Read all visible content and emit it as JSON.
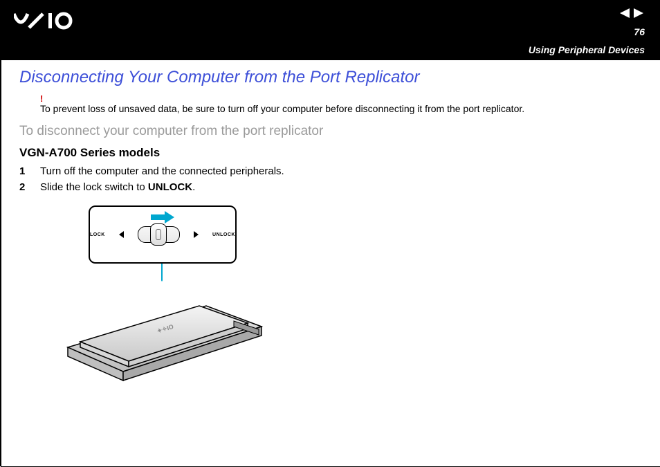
{
  "header": {
    "logo_text": "VAIO",
    "page_number": "76",
    "section": "Using Peripheral Devices"
  },
  "title": "Disconnecting Your Computer from the Port Replicator",
  "warning": {
    "mark": "!",
    "text": "To prevent loss of unsaved data, be sure to turn off your computer before disconnecting it from the port replicator."
  },
  "subhead": "To disconnect your computer from the port replicator",
  "model_heading": "VGN-A700 Series models",
  "steps": [
    {
      "num": "1",
      "text": "Turn off the computer and the connected peripherals."
    },
    {
      "num": "2",
      "text_prefix": "Slide the lock switch to ",
      "text_bold": "UNLOCK",
      "text_suffix": "."
    }
  ],
  "diagram": {
    "lock_label": "LOCK",
    "unlock_label": "UNLOCK"
  }
}
